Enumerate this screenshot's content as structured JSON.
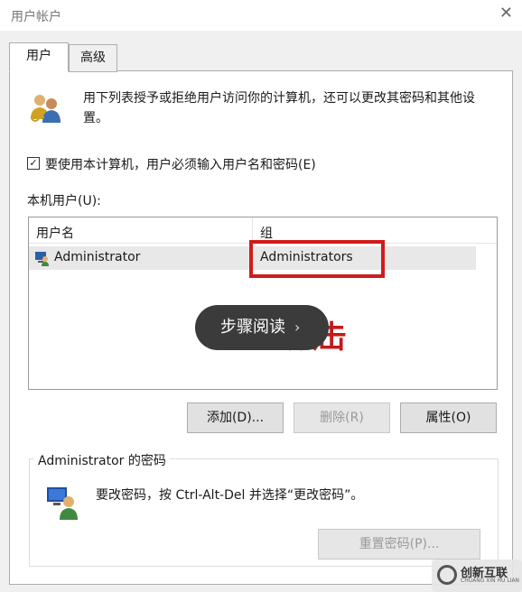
{
  "window": {
    "title": "用户帐户",
    "close_glyph": "✕"
  },
  "tabs": [
    {
      "label": "用户",
      "active": true
    },
    {
      "label": "高级",
      "active": false
    }
  ],
  "intro": {
    "text": "用下列表授予或拒绝用户访问你的计算机，还可以更改其密码和其他设置。",
    "icon": "users-icon"
  },
  "must_login": {
    "label": "要使用本计算机，用户必须输入用户名和密码(E)",
    "checked": true
  },
  "local_users": {
    "label": "本机用户(U):",
    "columns": [
      "用户名",
      "组"
    ],
    "rows": [
      {
        "name": "Administrator",
        "group": "Administrators"
      }
    ]
  },
  "overlay": {
    "text": "步骤阅读",
    "chevron": "›",
    "red_text": "双击"
  },
  "buttons": {
    "add": "添加(D)...",
    "remove": "删除(R)",
    "properties": "属性(O)"
  },
  "password_section": {
    "title": "Administrator 的密码",
    "text": "要改密码，按 Ctrl-Alt-Del 并选择“更改密码”。",
    "reset_button": "重置密码(P)..."
  },
  "watermark": {
    "name": "创新互联",
    "sub": "CHUANG XIN HU LIAN"
  },
  "colors": {
    "highlight": "#d01b1b",
    "overlay_bg": "#3b3b3b"
  }
}
